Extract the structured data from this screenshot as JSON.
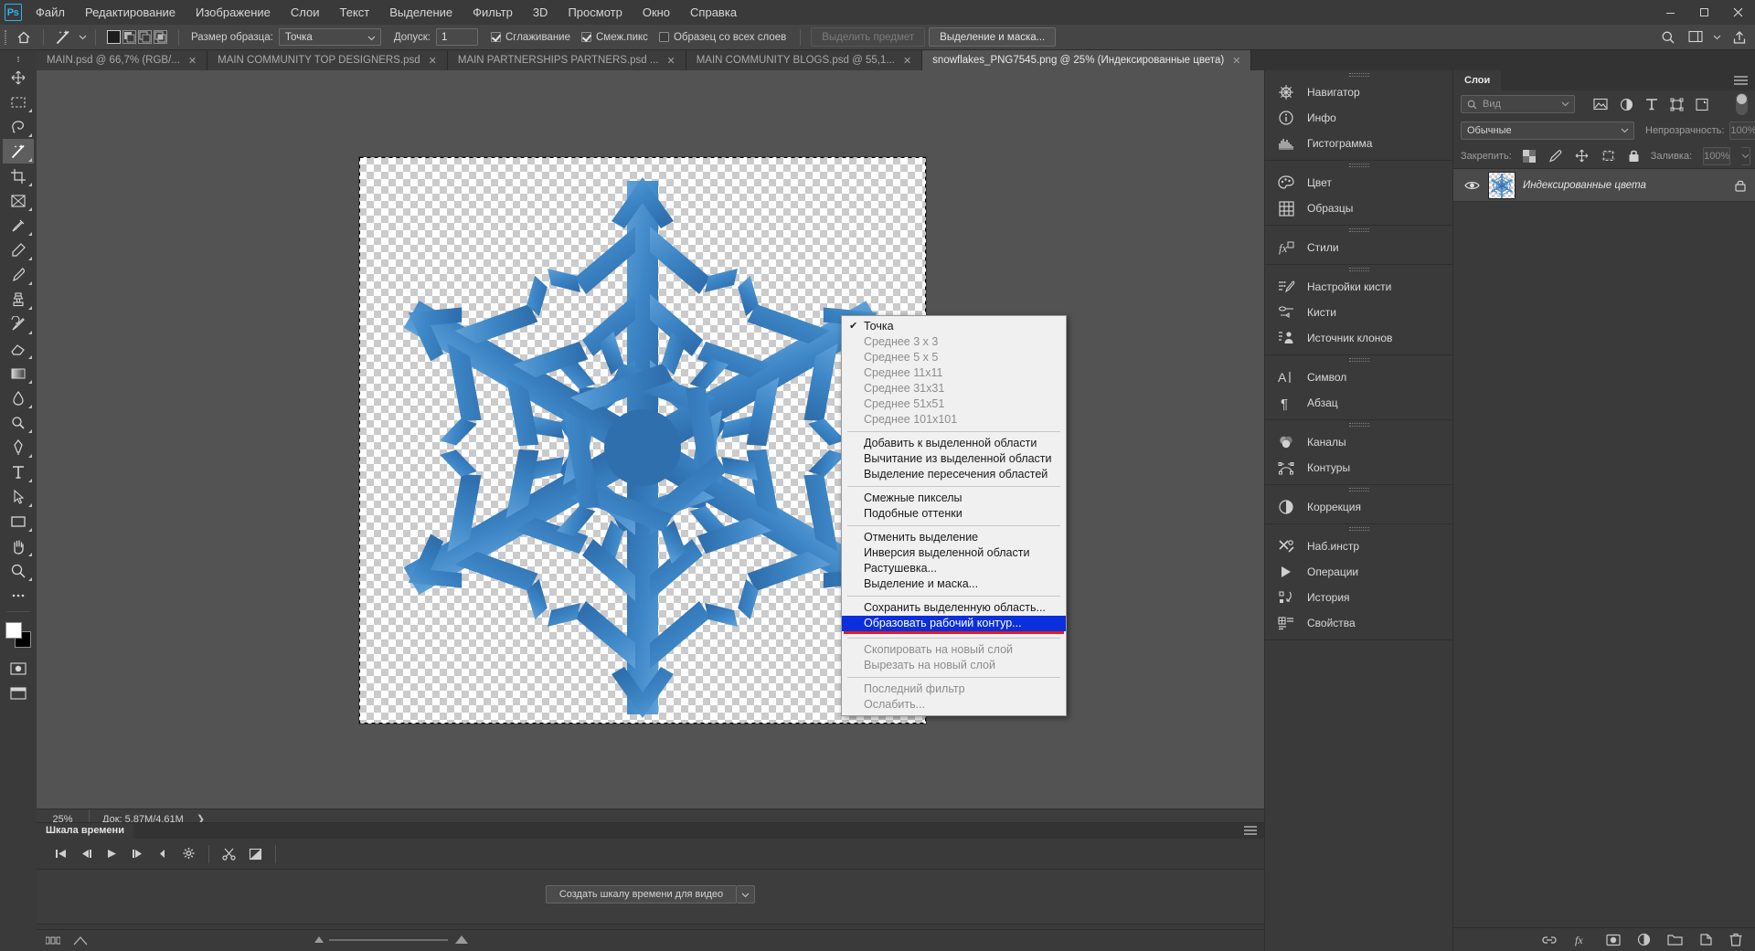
{
  "app": {
    "logo": "Ps",
    "window_controls": [
      "minimize",
      "maximize",
      "close"
    ]
  },
  "menubar": {
    "items": [
      {
        "label": "Файл"
      },
      {
        "label": "Редактирование"
      },
      {
        "label": "Изображение"
      },
      {
        "label": "Слои"
      },
      {
        "label": "Текст"
      },
      {
        "label": "Выделение"
      },
      {
        "label": "Фильтр"
      },
      {
        "label": "3D"
      },
      {
        "label": "Просмотр"
      },
      {
        "label": "Окно"
      },
      {
        "label": "Справка"
      }
    ]
  },
  "options_bar": {
    "tool_icon": "magic-wand-icon",
    "sample_size_label": "Размер образца:",
    "sample_size_value": "Точка",
    "tolerance_label": "Допуск:",
    "tolerance_value": "1",
    "antialias_label": "Сглаживание",
    "antialias_checked": true,
    "contiguous_label": "Смеж.пикс",
    "contiguous_checked": true,
    "all_layers_label": "Образец со всех слоев",
    "all_layers_checked": false,
    "select_subject_label": "Выделить предмет",
    "select_subject_disabled": true,
    "select_and_mask_label": "Выделение и маска..."
  },
  "tabs": [
    {
      "title": "MAIN.psd @ 66,7% (RGB/...",
      "active": false
    },
    {
      "title": "MAIN COMMUNITY TOP DESIGNERS.psd",
      "active": false
    },
    {
      "title": "MAIN PARTNERSHIPS PARTNERS.psd ...",
      "active": false
    },
    {
      "title": "MAIN COMMUNITY BLOGS.psd @ 55,1...",
      "active": false
    },
    {
      "title": "snowflakes_PNG7545.png @ 25% (Индексированные цвета)",
      "active": true
    }
  ],
  "toolbar": {
    "tools": [
      {
        "name": "move-tool"
      },
      {
        "name": "rectangular-marquee-tool"
      },
      {
        "name": "lasso-tool"
      },
      {
        "name": "magic-wand-tool",
        "selected": true
      },
      {
        "name": "crop-tool"
      },
      {
        "name": "frame-tool"
      },
      {
        "name": "eyedropper-tool"
      },
      {
        "name": "spot-healing-brush-tool"
      },
      {
        "name": "brush-tool"
      },
      {
        "name": "clone-stamp-tool"
      },
      {
        "name": "history-brush-tool"
      },
      {
        "name": "eraser-tool"
      },
      {
        "name": "gradient-tool"
      },
      {
        "name": "blur-tool"
      },
      {
        "name": "dodge-tool"
      },
      {
        "name": "pen-tool"
      },
      {
        "name": "type-tool"
      },
      {
        "name": "path-selection-tool"
      },
      {
        "name": "rectangle-tool"
      },
      {
        "name": "hand-tool"
      },
      {
        "name": "zoom-tool"
      },
      {
        "name": "more-tools"
      }
    ],
    "foreground_color": "#ffffff",
    "background_color": "#000000"
  },
  "context_menu": {
    "groups": [
      {
        "items": [
          {
            "label": "Точка",
            "checked": true,
            "disabled": false,
            "selected": false
          },
          {
            "label": "Среднее 3 x 3",
            "checked": false,
            "disabled": true,
            "selected": false
          },
          {
            "label": "Среднее 5 x 5",
            "checked": false,
            "disabled": true,
            "selected": false
          },
          {
            "label": "Среднее 11x11",
            "checked": false,
            "disabled": true,
            "selected": false
          },
          {
            "label": "Среднее 31x31",
            "checked": false,
            "disabled": true,
            "selected": false
          },
          {
            "label": "Среднее 51x51",
            "checked": false,
            "disabled": true,
            "selected": false
          },
          {
            "label": "Среднее 101x101",
            "checked": false,
            "disabled": true,
            "selected": false
          }
        ]
      },
      {
        "items": [
          {
            "label": "Добавить к выделенной области",
            "checked": false,
            "disabled": false,
            "selected": false
          },
          {
            "label": "Вычитание из выделенной области",
            "checked": false,
            "disabled": false,
            "selected": false
          },
          {
            "label": "Выделение пересечения областей",
            "checked": false,
            "disabled": false,
            "selected": false
          }
        ]
      },
      {
        "items": [
          {
            "label": "Смежные пикселы",
            "checked": false,
            "disabled": false,
            "selected": false
          },
          {
            "label": "Подобные оттенки",
            "checked": false,
            "disabled": false,
            "selected": false
          }
        ]
      },
      {
        "items": [
          {
            "label": "Отменить выделение",
            "checked": false,
            "disabled": false,
            "selected": false
          },
          {
            "label": "Инверсия выделенной области",
            "checked": false,
            "disabled": false,
            "selected": false
          },
          {
            "label": "Растушевка...",
            "checked": false,
            "disabled": false,
            "selected": false
          },
          {
            "label": "Выделение и маска...",
            "checked": false,
            "disabled": false,
            "selected": false
          }
        ]
      },
      {
        "items": [
          {
            "label": "Сохранить выделенную область...",
            "checked": false,
            "disabled": false,
            "selected": false
          },
          {
            "label": "Образовать рабочий контур...",
            "checked": false,
            "disabled": false,
            "selected": true
          }
        ]
      },
      {
        "items": [
          {
            "label": "Скопировать на новый слой",
            "checked": false,
            "disabled": true,
            "selected": false
          },
          {
            "label": "Вырезать на новый слой",
            "checked": false,
            "disabled": true,
            "selected": false
          }
        ]
      },
      {
        "items": [
          {
            "label": "Последний фильтр",
            "checked": false,
            "disabled": true,
            "selected": false
          },
          {
            "label": "Ослабить...",
            "checked": false,
            "disabled": true,
            "selected": false
          }
        ]
      }
    ],
    "highlight_color": "#0a2fdc",
    "underline_color": "#e01b24"
  },
  "status_bar": {
    "zoom": "25%",
    "doc_info": "Док: 5,87M/4,61M"
  },
  "timeline": {
    "tab_label": "Шкала времени",
    "create_button": "Создать шкалу времени для видео",
    "controls": [
      "go-to-first-frame",
      "previous-frame",
      "play",
      "next-frame",
      "audio",
      "settings",
      "split-clip",
      "transition"
    ]
  },
  "dock": {
    "groups": [
      {
        "items": [
          {
            "label": "Навигатор",
            "icon": "navigator-icon"
          },
          {
            "label": "Инфо",
            "icon": "info-icon"
          },
          {
            "label": "Гистограмма",
            "icon": "histogram-icon"
          }
        ]
      },
      {
        "items": [
          {
            "label": "Цвет",
            "icon": "color-palette-icon"
          },
          {
            "label": "Образцы",
            "icon": "swatches-grid-icon"
          }
        ]
      },
      {
        "items": [
          {
            "label": "Стили",
            "icon": "styles-fx-icon"
          }
        ]
      },
      {
        "items": [
          {
            "label": "Настройки кисти",
            "icon": "brush-settings-icon"
          },
          {
            "label": "Кисти",
            "icon": "brushes-icon"
          },
          {
            "label": "Источник клонов",
            "icon": "clone-source-icon"
          }
        ]
      },
      {
        "items": [
          {
            "label": "Символ",
            "icon": "character-icon"
          },
          {
            "label": "Абзац",
            "icon": "paragraph-icon"
          }
        ]
      },
      {
        "items": [
          {
            "label": "Каналы",
            "icon": "channels-icon"
          },
          {
            "label": "Контуры",
            "icon": "paths-icon"
          }
        ]
      },
      {
        "items": [
          {
            "label": "Коррекция",
            "icon": "adjustments-icon"
          }
        ]
      },
      {
        "items": [
          {
            "label": "Наб.инстр",
            "icon": "tool-presets-icon"
          },
          {
            "label": "Операции",
            "icon": "actions-play-icon"
          },
          {
            "label": "История",
            "icon": "history-icon"
          },
          {
            "label": "Свойства",
            "icon": "properties-icon"
          }
        ]
      }
    ]
  },
  "layers_panel": {
    "tab_label": "Слои",
    "search_placeholder": "Вид",
    "filter_icons": [
      "filter-image-icon",
      "filter-adjustment-icon",
      "filter-type-icon",
      "filter-shape-icon",
      "filter-smart-object-icon"
    ],
    "blend_mode": "Обычные",
    "opacity_label": "Непрозрачность:",
    "opacity_value": "100%",
    "lock_label": "Закрепить:",
    "lock_icons": [
      "lock-transparent-pixels-icon",
      "lock-image-pixels-icon",
      "lock-position-icon",
      "lock-artboard-icon",
      "lock-all-icon"
    ],
    "fill_label": "Заливка:",
    "fill_value": "100%",
    "layers": [
      {
        "name": "Индексированные цвета",
        "visible": true,
        "locked": true
      }
    ],
    "footer_icons": [
      "link-layers-icon",
      "layer-style-fx-icon",
      "layer-mask-icon",
      "new-fill-adjustment-icon",
      "new-group-icon",
      "new-layer-icon",
      "delete-layer-icon"
    ]
  }
}
